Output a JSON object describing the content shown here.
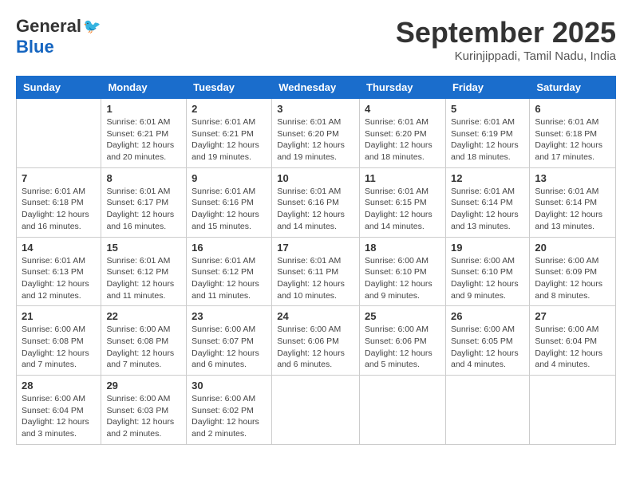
{
  "header": {
    "logo_general": "General",
    "logo_blue": "Blue",
    "month_title": "September 2025",
    "location": "Kurinjippadi, Tamil Nadu, India"
  },
  "days_of_week": [
    "Sunday",
    "Monday",
    "Tuesday",
    "Wednesday",
    "Thursday",
    "Friday",
    "Saturday"
  ],
  "weeks": [
    [
      {
        "day": "",
        "info": ""
      },
      {
        "day": "1",
        "info": "Sunrise: 6:01 AM\nSunset: 6:21 PM\nDaylight: 12 hours\nand 20 minutes."
      },
      {
        "day": "2",
        "info": "Sunrise: 6:01 AM\nSunset: 6:21 PM\nDaylight: 12 hours\nand 19 minutes."
      },
      {
        "day": "3",
        "info": "Sunrise: 6:01 AM\nSunset: 6:20 PM\nDaylight: 12 hours\nand 19 minutes."
      },
      {
        "day": "4",
        "info": "Sunrise: 6:01 AM\nSunset: 6:20 PM\nDaylight: 12 hours\nand 18 minutes."
      },
      {
        "day": "5",
        "info": "Sunrise: 6:01 AM\nSunset: 6:19 PM\nDaylight: 12 hours\nand 18 minutes."
      },
      {
        "day": "6",
        "info": "Sunrise: 6:01 AM\nSunset: 6:18 PM\nDaylight: 12 hours\nand 17 minutes."
      }
    ],
    [
      {
        "day": "7",
        "info": "Sunrise: 6:01 AM\nSunset: 6:18 PM\nDaylight: 12 hours\nand 16 minutes."
      },
      {
        "day": "8",
        "info": "Sunrise: 6:01 AM\nSunset: 6:17 PM\nDaylight: 12 hours\nand 16 minutes."
      },
      {
        "day": "9",
        "info": "Sunrise: 6:01 AM\nSunset: 6:16 PM\nDaylight: 12 hours\nand 15 minutes."
      },
      {
        "day": "10",
        "info": "Sunrise: 6:01 AM\nSunset: 6:16 PM\nDaylight: 12 hours\nand 14 minutes."
      },
      {
        "day": "11",
        "info": "Sunrise: 6:01 AM\nSunset: 6:15 PM\nDaylight: 12 hours\nand 14 minutes."
      },
      {
        "day": "12",
        "info": "Sunrise: 6:01 AM\nSunset: 6:14 PM\nDaylight: 12 hours\nand 13 minutes."
      },
      {
        "day": "13",
        "info": "Sunrise: 6:01 AM\nSunset: 6:14 PM\nDaylight: 12 hours\nand 13 minutes."
      }
    ],
    [
      {
        "day": "14",
        "info": "Sunrise: 6:01 AM\nSunset: 6:13 PM\nDaylight: 12 hours\nand 12 minutes."
      },
      {
        "day": "15",
        "info": "Sunrise: 6:01 AM\nSunset: 6:12 PM\nDaylight: 12 hours\nand 11 minutes."
      },
      {
        "day": "16",
        "info": "Sunrise: 6:01 AM\nSunset: 6:12 PM\nDaylight: 12 hours\nand 11 minutes."
      },
      {
        "day": "17",
        "info": "Sunrise: 6:01 AM\nSunset: 6:11 PM\nDaylight: 12 hours\nand 10 minutes."
      },
      {
        "day": "18",
        "info": "Sunrise: 6:00 AM\nSunset: 6:10 PM\nDaylight: 12 hours\nand 9 minutes."
      },
      {
        "day": "19",
        "info": "Sunrise: 6:00 AM\nSunset: 6:10 PM\nDaylight: 12 hours\nand 9 minutes."
      },
      {
        "day": "20",
        "info": "Sunrise: 6:00 AM\nSunset: 6:09 PM\nDaylight: 12 hours\nand 8 minutes."
      }
    ],
    [
      {
        "day": "21",
        "info": "Sunrise: 6:00 AM\nSunset: 6:08 PM\nDaylight: 12 hours\nand 7 minutes."
      },
      {
        "day": "22",
        "info": "Sunrise: 6:00 AM\nSunset: 6:08 PM\nDaylight: 12 hours\nand 7 minutes."
      },
      {
        "day": "23",
        "info": "Sunrise: 6:00 AM\nSunset: 6:07 PM\nDaylight: 12 hours\nand 6 minutes."
      },
      {
        "day": "24",
        "info": "Sunrise: 6:00 AM\nSunset: 6:06 PM\nDaylight: 12 hours\nand 6 minutes."
      },
      {
        "day": "25",
        "info": "Sunrise: 6:00 AM\nSunset: 6:06 PM\nDaylight: 12 hours\nand 5 minutes."
      },
      {
        "day": "26",
        "info": "Sunrise: 6:00 AM\nSunset: 6:05 PM\nDaylight: 12 hours\nand 4 minutes."
      },
      {
        "day": "27",
        "info": "Sunrise: 6:00 AM\nSunset: 6:04 PM\nDaylight: 12 hours\nand 4 minutes."
      }
    ],
    [
      {
        "day": "28",
        "info": "Sunrise: 6:00 AM\nSunset: 6:04 PM\nDaylight: 12 hours\nand 3 minutes."
      },
      {
        "day": "29",
        "info": "Sunrise: 6:00 AM\nSunset: 6:03 PM\nDaylight: 12 hours\nand 2 minutes."
      },
      {
        "day": "30",
        "info": "Sunrise: 6:00 AM\nSunset: 6:02 PM\nDaylight: 12 hours\nand 2 minutes."
      },
      {
        "day": "",
        "info": ""
      },
      {
        "day": "",
        "info": ""
      },
      {
        "day": "",
        "info": ""
      },
      {
        "day": "",
        "info": ""
      }
    ]
  ]
}
